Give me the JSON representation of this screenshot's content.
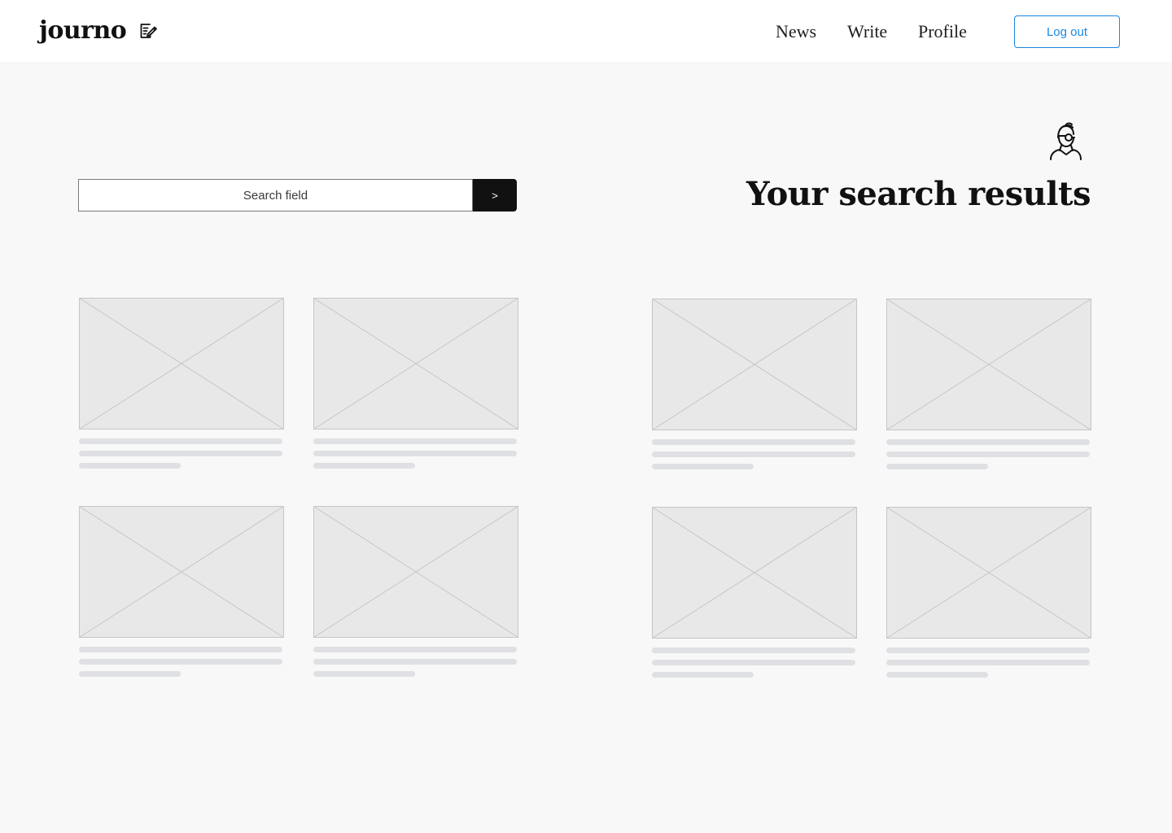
{
  "header": {
    "logo": "journo",
    "nav": [
      {
        "label": "News"
      },
      {
        "label": "Write"
      },
      {
        "label": "Profile"
      }
    ],
    "logout_label": "Log out"
  },
  "search": {
    "placeholder": "Search field",
    "submit_label": ">"
  },
  "main": {
    "title": "Your search results"
  },
  "icons": {
    "logo": "edit-note-icon",
    "avatar": "user-avatar-icon"
  },
  "colors": {
    "accent": "#1a87e2",
    "page_background": "#f8f8f8",
    "search_button": "#111111",
    "placeholder_fill": "#e8e8e8",
    "skeleton_bar": "#dfe0e3"
  }
}
